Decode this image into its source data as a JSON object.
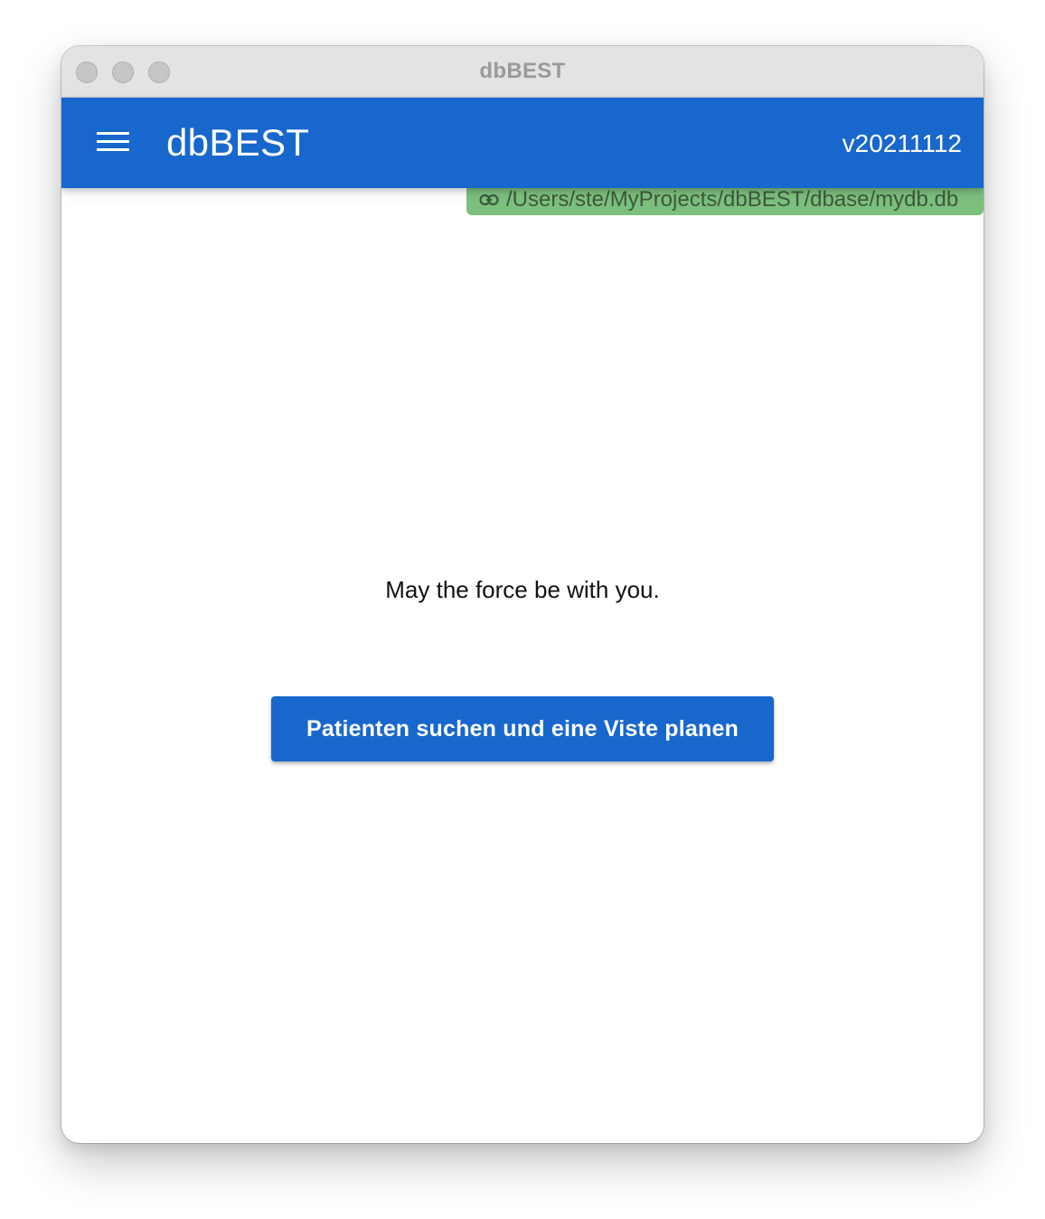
{
  "window": {
    "title": "dbBEST"
  },
  "appbar": {
    "menu_icon": "hamburger-menu-icon",
    "title": "dbBEST",
    "version": "v20211112",
    "color": "#1867cd"
  },
  "db_chip": {
    "icon": "link-icon",
    "path": "/Users/ste/MyProjects/dbBEST/dbase/mydb.db",
    "color": "#7dc07e"
  },
  "main": {
    "message": "May the force be with you.",
    "button_label": "Patienten suchen und eine Viste planen"
  }
}
